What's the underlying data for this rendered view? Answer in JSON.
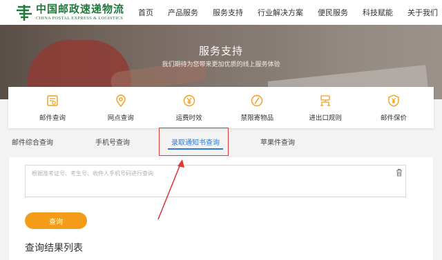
{
  "header": {
    "logo_cn": "中国邮政速递物流",
    "logo_en": "CHINA POSTAL EXPRESS & LOGISTICS",
    "nav": [
      "首页",
      "产品服务",
      "服务支持",
      "行业解决方案",
      "便民服务",
      "科技赋能",
      "关于我们"
    ]
  },
  "banner": {
    "title": "服务支持",
    "subtitle": "我们期待为您带来更加优质的线上服务体验"
  },
  "services": [
    {
      "label": "邮件查询",
      "icon": "mail-search-icon"
    },
    {
      "label": "网点查询",
      "icon": "location-pin-icon"
    },
    {
      "label": "运费时效",
      "icon": "yen-coin-icon"
    },
    {
      "label": "禁限寄物品",
      "icon": "prohibited-icon"
    },
    {
      "label": "进出口规则",
      "icon": "customs-rules-icon"
    },
    {
      "label": "邮件保价",
      "icon": "yen-shield-icon"
    }
  ],
  "tabs": [
    {
      "label": "邮件综合查询",
      "active": false
    },
    {
      "label": "手机号查询",
      "active": false
    },
    {
      "label": "录取通知书查询",
      "active": true
    },
    {
      "label": "苹果件查询",
      "active": false
    }
  ],
  "query": {
    "placeholder": "根据准考证号、考生号、收件人手机号码进行查询",
    "button_label": "查询",
    "results_title": "查询结果列表"
  },
  "colors": {
    "brand_green": "#1e7a3a",
    "accent_orange": "#f39c18",
    "active_tab_blue": "#2b7bd6",
    "annotation_red": "#e0393a"
  }
}
